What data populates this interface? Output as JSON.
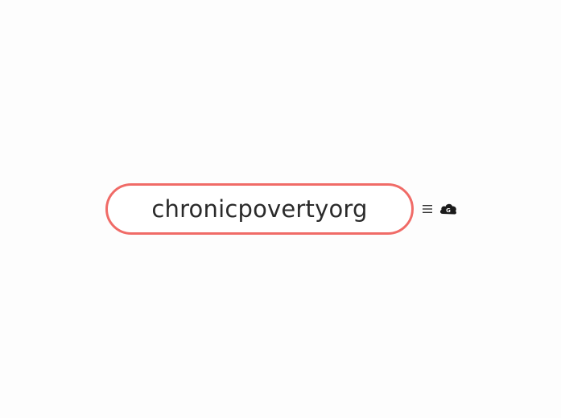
{
  "mindmap": {
    "root": {
      "label": "chronicpovertyorg",
      "border_color": "#f06b67"
    },
    "controls": {
      "menu_icon": "hamburger-menu-icon",
      "cloud_icon": "cloud-g-icon",
      "cloud_badge_letter": "G"
    }
  }
}
